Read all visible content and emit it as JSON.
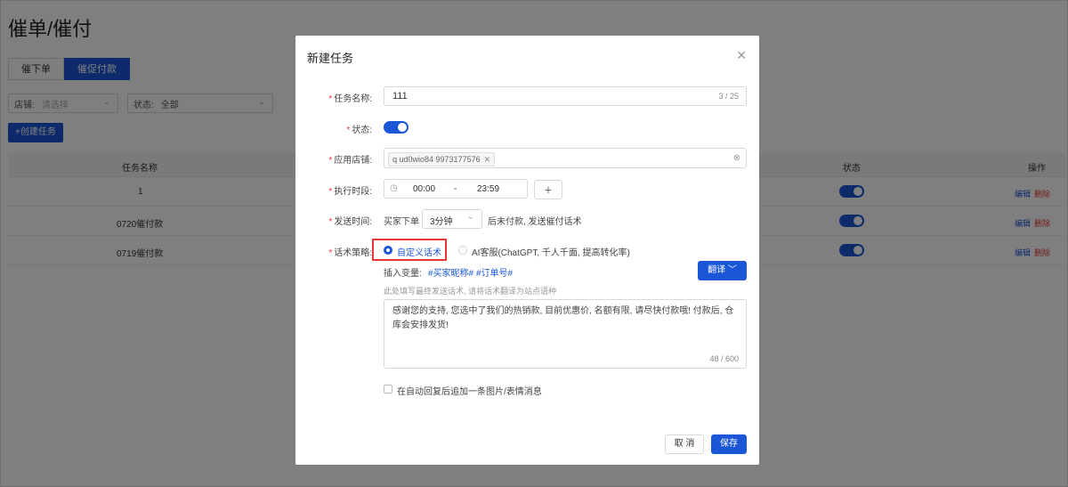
{
  "page": {
    "title": "催单/催付",
    "tabs": [
      {
        "label": "催下单"
      },
      {
        "label": "催促付款"
      }
    ],
    "filters": {
      "shop_label": "店铺:",
      "shop_placeholder": "请选择",
      "status_label": "状态:",
      "status_value": "全部"
    },
    "create_button": "+创建任务",
    "table": {
      "headers": {
        "task_name": "任务名称",
        "status": "状态",
        "actions": "操作"
      },
      "rows": [
        {
          "name": "1",
          "enabled": true
        },
        {
          "name": "0720催付款",
          "enabled": true
        },
        {
          "name": "0719催付款",
          "enabled": true
        }
      ],
      "edit_label": "编辑",
      "delete_label": "删除"
    }
  },
  "modal": {
    "title": "新建任务",
    "fields": {
      "task_name": {
        "label": "任务名称:",
        "value": "111",
        "counter": "3 / 25"
      },
      "status": {
        "label": "状态:",
        "enabled": true
      },
      "shop": {
        "label": "应用店铺:",
        "tag": "q ud0wio84 9973177576"
      },
      "period": {
        "label": "执行时段:",
        "start": "00:00",
        "separator": "-",
        "end": "23:59",
        "add": "+"
      },
      "send_time": {
        "label": "发送时间:",
        "prefix": "买家下单",
        "value": "3分钟",
        "suffix": "后未付款, 发送催付话术"
      },
      "strategy": {
        "label": "话术策略:",
        "options": [
          {
            "label": "自定义话术",
            "selected": true
          },
          {
            "label": "AI客服(ChatGPT, 千人千面, 提高转化率)",
            "selected": false
          }
        ],
        "insert_label": "插入变量:",
        "variables": [
          "#买家昵称#",
          "#订单号#"
        ],
        "translate_button": "翻译",
        "hint": "此处填写最终发送话术, 请将话术翻译为站点语种",
        "message": "感谢您的支持, 您选中了我们的热销款, 目前优惠价, 名额有限, 请尽快付款哦! 付款后, 仓库会安排发货!",
        "counter": "48 / 600",
        "append_option": "在自动回复后追加一条图片/表情消息"
      }
    },
    "cancel": "取 消",
    "save": "保存"
  },
  "colors": {
    "accent": "#1a56d6",
    "danger": "#e53935"
  }
}
